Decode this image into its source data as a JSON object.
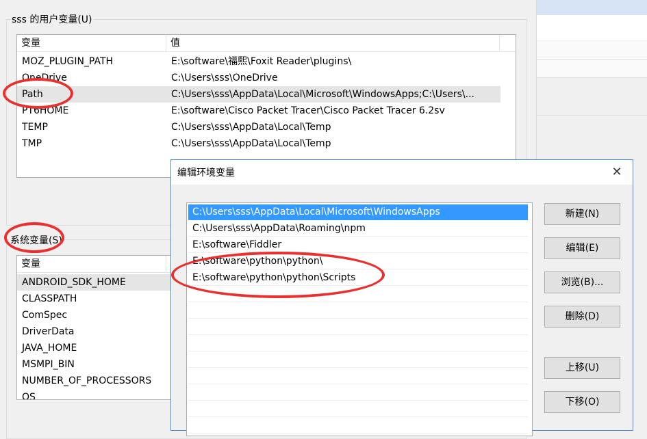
{
  "user_vars": {
    "group_title": "sss 的用户变量(U)",
    "columns": [
      "变量",
      "值"
    ],
    "rows": [
      {
        "name": "MOZ_PLUGIN_PATH",
        "value": "E:\\software\\福熙\\Foxit Reader\\plugins\\"
      },
      {
        "name": "OneDrive",
        "value": "C:\\Users\\sss\\OneDrive"
      },
      {
        "name": "Path",
        "value": "C:\\Users\\sss\\AppData\\Local\\Microsoft\\WindowsApps;C:\\Users\\..."
      },
      {
        "name": "PT6HOME",
        "value": "E:\\software\\Cisco Packet Tracer\\Cisco Packet Tracer 6.2sv"
      },
      {
        "name": "TEMP",
        "value": "C:\\Users\\sss\\AppData\\Local\\Temp"
      },
      {
        "name": "TMP",
        "value": "C:\\Users\\sss\\AppData\\Local\\Temp"
      }
    ],
    "selected_index": 2
  },
  "system_vars": {
    "group_title": "系统变量(S)",
    "columns": [
      "变量"
    ],
    "rows": [
      "ANDROID_SDK_HOME",
      "CLASSPATH",
      "ComSpec",
      "DriverData",
      "JAVA_HOME",
      "MSMPI_BIN",
      "NUMBER_OF_PROCESSORS",
      "OS"
    ]
  },
  "edit_dialog": {
    "title": "编辑环境变量",
    "close_glyph": "✕",
    "entries": [
      "C:\\Users\\sss\\AppData\\Local\\Microsoft\\WindowsApps",
      "C:\\Users\\sss\\AppData\\Roaming\\npm",
      "E:\\software\\Fiddler",
      "E:\\software\\python\\python\\",
      "E:\\software\\python\\python\\Scripts"
    ],
    "selected_index": 0,
    "buttons": {
      "new": "新建(N)",
      "edit": "编辑(E)",
      "browse": "浏览(B)...",
      "delete": "删除(D)",
      "move_up": "上移(U)",
      "move_down": "下移(O)"
    }
  },
  "colors": {
    "selection": "#3399ff",
    "annotation": "#e8302e",
    "dialog_border": "#4a8ad6"
  }
}
